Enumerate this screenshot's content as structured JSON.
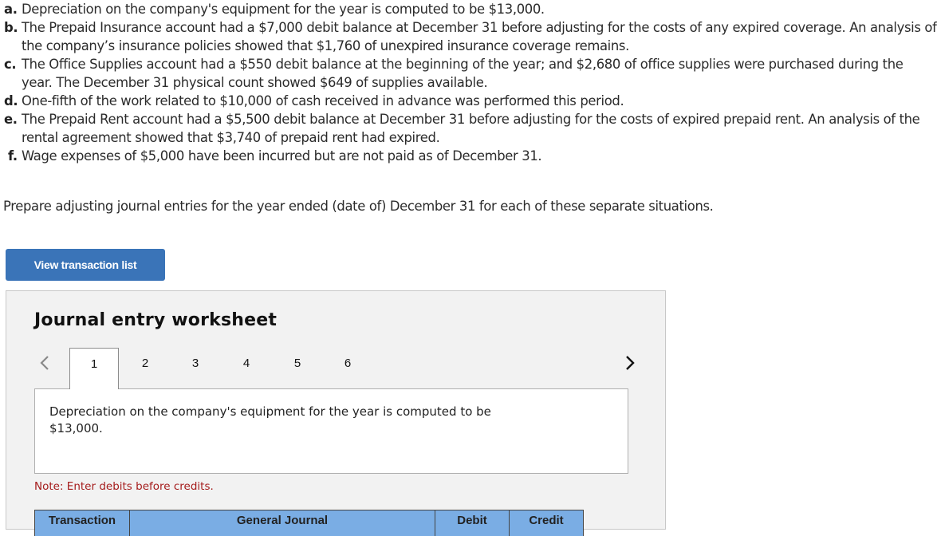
{
  "problem": {
    "items": [
      {
        "letter": "a.",
        "text": "Depreciation on the company's equipment for the year is computed to be $13,000."
      },
      {
        "letter": "b.",
        "text": "The Prepaid Insurance account had a $7,000 debit balance at December 31 before adjusting for the costs of any expired coverage. An analysis of the company’s insurance policies showed that $1,760 of unexpired insurance coverage remains."
      },
      {
        "letter": "c.",
        "text": "The Office Supplies account had a $550 debit balance at the beginning of the year; and $2,680 of office supplies were purchased during the year. The December 31 physical count showed $649 of supplies available."
      },
      {
        "letter": "d.",
        "text": "One-fifth of the work related to $10,000 of cash received in advance was performed this period."
      },
      {
        "letter": "e.",
        "text": "The Prepaid Rent account had a $5,500 debit balance at December 31 before adjusting for the costs of expired prepaid rent. An analysis of the rental agreement showed that $3,740 of prepaid rent had expired."
      },
      {
        "letter": "f.",
        "text": "Wage expenses of $5,000 have been incurred but are not paid as of December 31."
      }
    ],
    "instruction": "Prepare adjusting journal entries for the year ended (date of) December 31 for each of these separate situations."
  },
  "buttons": {
    "view_transaction_list": "View transaction list"
  },
  "worksheet": {
    "title": "Journal entry worksheet",
    "tabs": [
      "1",
      "2",
      "3",
      "4",
      "5",
      "6"
    ],
    "active_tab": "1",
    "description": "Depreciation on the company's equipment for the year is computed to be $13,000.",
    "note": "Note: Enter debits before credits.",
    "table": {
      "headers": [
        "Transaction",
        "General Journal",
        "Debit",
        "Credit"
      ]
    }
  },
  "colors": {
    "button_bg": "#3a74b8",
    "table_header_bg": "#7aade4",
    "note_text": "#a51c1c",
    "worksheet_bg": "#f2f2f2"
  }
}
